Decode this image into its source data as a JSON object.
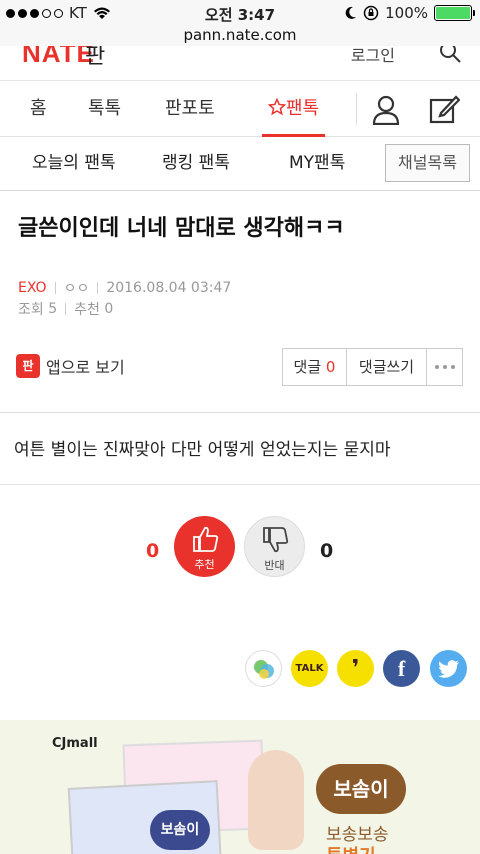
{
  "status_bar": {
    "carrier": "KT",
    "time": "오전 3:47",
    "battery": "100%",
    "battery_level": 1.0
  },
  "browser": {
    "url": "pann.nate.com"
  },
  "header": {
    "logo": "NATE",
    "section": "판",
    "login": "로그인"
  },
  "main_nav": {
    "items": [
      "홈",
      "톡톡",
      "판포토",
      "팬톡"
    ],
    "active": "팬톡",
    "active_icon": "star-icon"
  },
  "sub_nav": {
    "items": [
      "오늘의 팬톡",
      "랭킹 팬톡",
      "MY팬톡"
    ],
    "channel_button": "채널목록"
  },
  "post": {
    "title": "글쓴이인데 너네 맘대로 생각해ㅋㅋ",
    "category": "EXO",
    "author": "ㅇㅇ",
    "date": "2016.08.04 03:47",
    "views_label": "조회",
    "views": "5",
    "recommend_label": "추천",
    "recommend": "0",
    "body": "여튼 별이는 진짜맞아 다만 어떻게 얻었는지는 묻지마"
  },
  "actions": {
    "app_view": "앱으로 보기",
    "app_icon_text": "판",
    "comments_label": "댓글",
    "comments_count": "0",
    "write_comment": "댓글쓰기"
  },
  "vote": {
    "up_count": "0",
    "up_label": "추천",
    "down_count": "0",
    "down_label": "반대"
  },
  "share": {
    "talk": "TALK",
    "facebook": "f",
    "story": "❜"
  },
  "ad": {
    "brand": "CJmall",
    "product": "보솜이",
    "tagline": "보송보송",
    "tagline2": "투병기"
  },
  "colors": {
    "accent": "#e8322b",
    "kakao": "#f6e000",
    "facebook": "#3b5998",
    "twitter": "#55acee"
  }
}
